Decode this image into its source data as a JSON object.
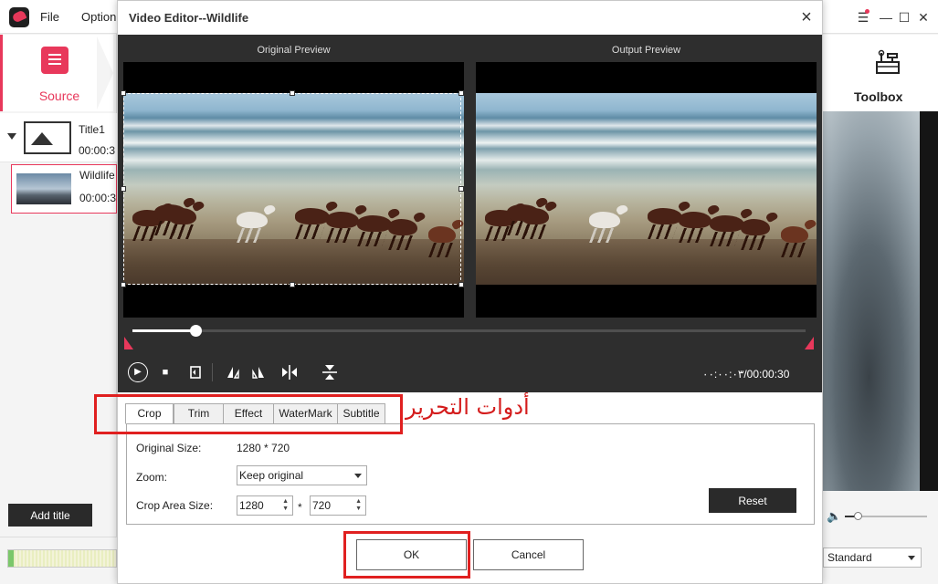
{
  "app": {
    "menu": [
      "File",
      "Option"
    ],
    "source_label": "Source",
    "toolbox_label": "Toolbox",
    "title_item": {
      "name": "Title1",
      "duration": "00:00:3"
    },
    "clip_item": {
      "name": "Wildlife",
      "duration": "00:00:3"
    },
    "add_title_label": "Add title",
    "quality_value": "Standard"
  },
  "dialog": {
    "title": "Video Editor--Wildlife",
    "close_glyph": "×",
    "original_preview_label": "Original Preview",
    "output_preview_label": "Output Preview",
    "time_display": "٠٠:٠٠:٠٣/00:00:30",
    "playback_progress": 0.093,
    "tabs": [
      "Crop",
      "Trim",
      "Effect",
      "WaterMark",
      "Subtitle"
    ],
    "active_tab": "Crop",
    "crop": {
      "original_size_label": "Original Size:",
      "original_size_value": "1280 * 720",
      "zoom_label": "Zoom:",
      "zoom_value": "Keep original",
      "crop_area_label": "Crop Area Size:",
      "crop_width": "1280",
      "crop_height": "720",
      "separator": "*",
      "reset_label": "Reset"
    },
    "ok_label": "OK",
    "cancel_label": "Cancel"
  },
  "annotation": {
    "text": "أدوات التحرير",
    "color": "#e02020"
  },
  "colors": {
    "accent": "#e8385b",
    "preview_bg": "#2e2e2e",
    "dark_button": "#2a2a2a"
  }
}
